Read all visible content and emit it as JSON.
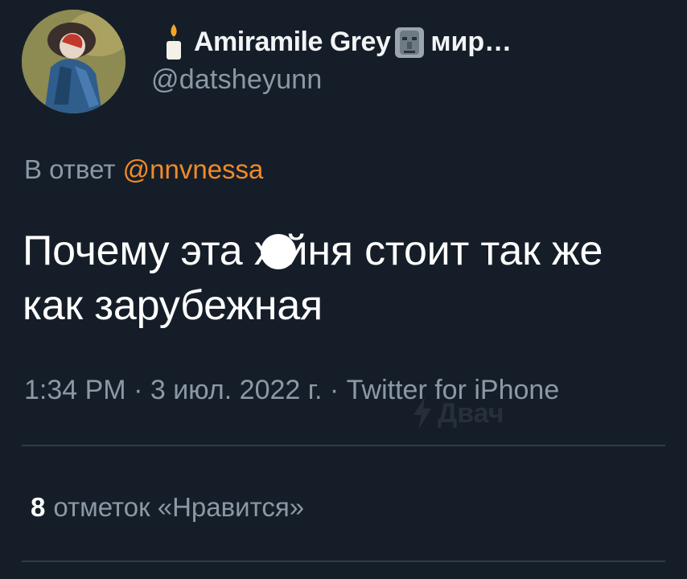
{
  "tweet": {
    "author": {
      "display_name": "Amiramile Grey",
      "display_name_suffix": "мир…",
      "handle": "@datsheyunn",
      "avatar_icon": "avatar-photo"
    },
    "reply_to": {
      "prefix": "В ответ",
      "mention": "@nnvnessa"
    },
    "text": {
      "before_censor": "Почему эта х",
      "after_censor": "йня стоит так же как зарубежная"
    },
    "meta": "1:34 PM · 3 июл. 2022 г. · Twitter for iPhone",
    "likes": {
      "count": "8",
      "label": "отметок «Нравится»"
    }
  },
  "watermark": {
    "text": "Двач"
  },
  "colors": {
    "background": "#151e28",
    "mention": "#f08a2a",
    "muted_text": "#8b98a5",
    "divider": "#2f3b47"
  },
  "icons": [
    "candle-icon",
    "moai-icon",
    "censor-dot",
    "bolt-icon"
  ]
}
